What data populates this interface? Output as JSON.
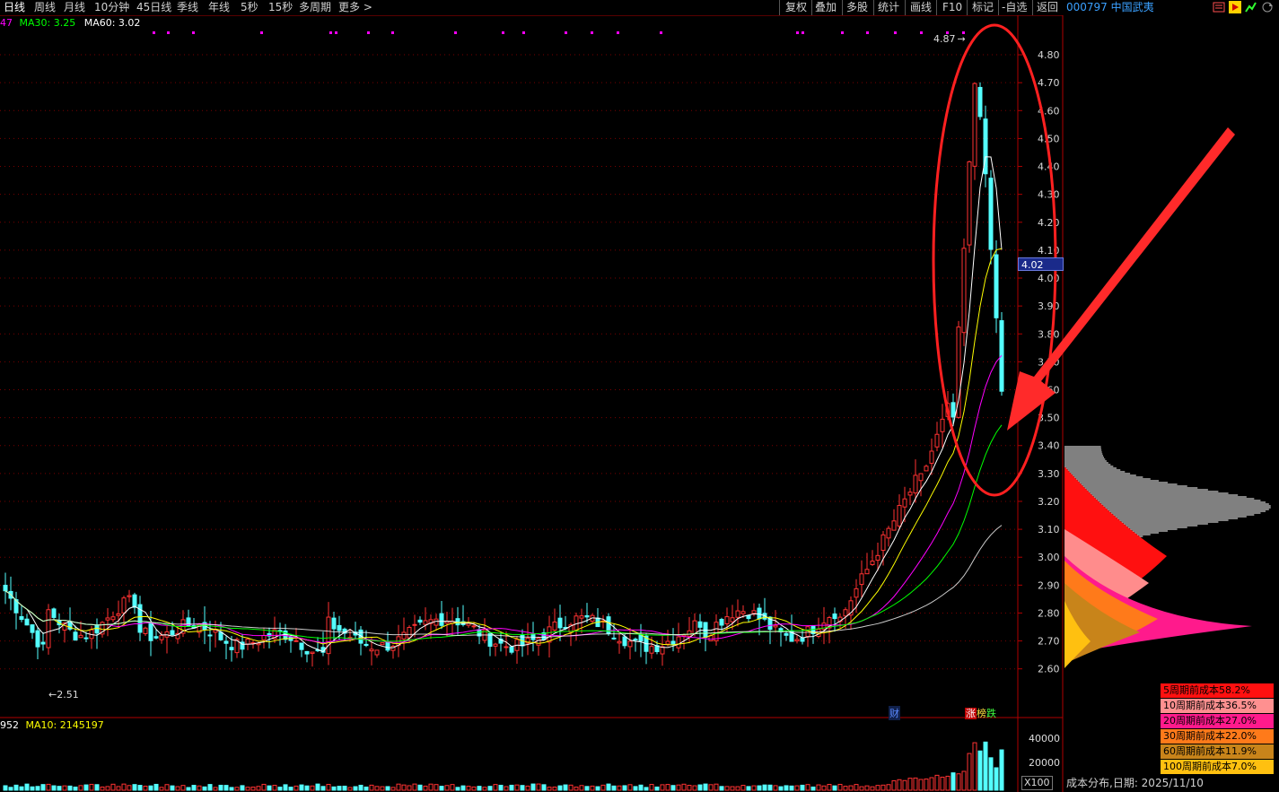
{
  "toolbar": {
    "periods": [
      "日线",
      "周线",
      "月线",
      "10分钟",
      "45日线",
      "季线",
      "年线",
      "5秒",
      "15秒",
      "多周期",
      "更多 >"
    ],
    "tools": [
      "复权",
      "叠加",
      "多股",
      "统计",
      "画线",
      "F10",
      "标记",
      "-自选",
      "返回"
    ]
  },
  "stock": {
    "code": "000797",
    "name": "中国武夷"
  },
  "ma_legend": {
    "ma_cut": "47",
    "ma30": "MA30: 3.25",
    "ma60": "MA60: 3.02"
  },
  "vol_legend": {
    "vol_cut": "952",
    "ma10": "MA10: 2145197"
  },
  "price_axis": [
    "4.80",
    "4.70",
    "4.60",
    "4.50",
    "4.40",
    "4.30",
    "4.20",
    "4.10",
    "4.00",
    "3.90",
    "3.80",
    "3.70",
    "3.60",
    "3.50",
    "3.40",
    "3.30",
    "3.20",
    "3.10",
    "3.00",
    "2.90",
    "2.80",
    "2.70",
    "2.60"
  ],
  "current_price": "4.02",
  "high_label": "4.87",
  "low_label": "2.51",
  "volume_axis": [
    "40000",
    "20000"
  ],
  "volume_unit": "X100",
  "markers": {
    "cai": "财",
    "zhang": "涨",
    "bang": "榜",
    "die": "跌"
  },
  "cost_legend": [
    {
      "label": "5周期前成本58.2%",
      "color": "#ff1010"
    },
    {
      "label": "10周期前成本36.5%",
      "color": "#ff8c8c"
    },
    {
      "label": "20周期前成本27.0%",
      "color": "#ff1a8c"
    },
    {
      "label": "30周期前成本22.0%",
      "color": "#ff7a1a"
    },
    {
      "label": "60周期前成本11.9%",
      "color": "#c8841a"
    },
    {
      "label": "100周期前成本7.0%",
      "color": "#ffc010"
    }
  ],
  "cost_date": "成本分布,日期:  2025/11/10",
  "colors": {
    "up": "#ff3232",
    "down": "#54ffff",
    "ma5": "#ffffff",
    "ma10": "#ffff00",
    "ma20": "#ff00ff",
    "ma30": "#00ff00",
    "ma60": "#ffffff",
    "annotation": "#ff2020"
  }
}
